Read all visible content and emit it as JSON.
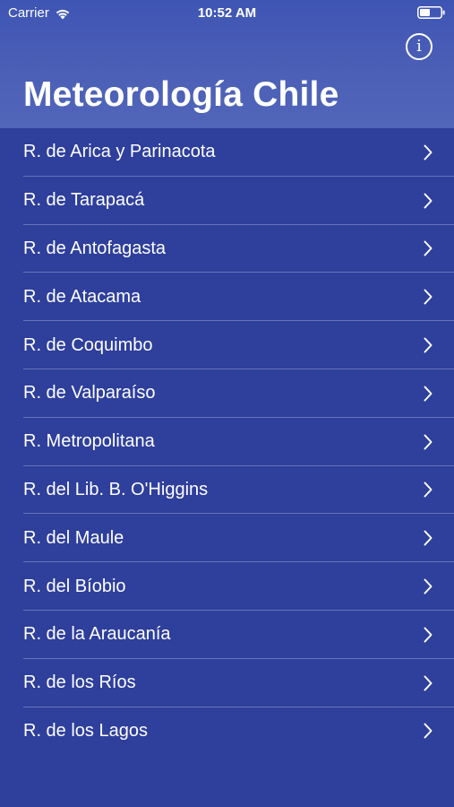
{
  "status_bar": {
    "carrier": "Carrier",
    "time": "10:52 AM",
    "wifi_icon": "wifi-icon",
    "battery_icon": "battery-icon"
  },
  "header": {
    "title": "Meteorología Chile",
    "info_button_icon": "info-icon"
  },
  "regions": [
    {
      "label": "R. de Arica y Parinacota"
    },
    {
      "label": "R. de Tarapacá"
    },
    {
      "label": "R. de Antofagasta"
    },
    {
      "label": "R. de Atacama"
    },
    {
      "label": "R. de Coquimbo"
    },
    {
      "label": "R. de Valparaíso"
    },
    {
      "label": "R. Metropolitana"
    },
    {
      "label": "R. del Lib. B. O'Higgins"
    },
    {
      "label": "R. del Maule"
    },
    {
      "label": "R. del Bíobio"
    },
    {
      "label": "R. de la Araucanía"
    },
    {
      "label": "R. de los Ríos"
    },
    {
      "label": "R. de los Lagos"
    }
  ],
  "colors": {
    "background": "#2e3f9c",
    "header": "#4c60b7",
    "text": "#ffffff"
  }
}
